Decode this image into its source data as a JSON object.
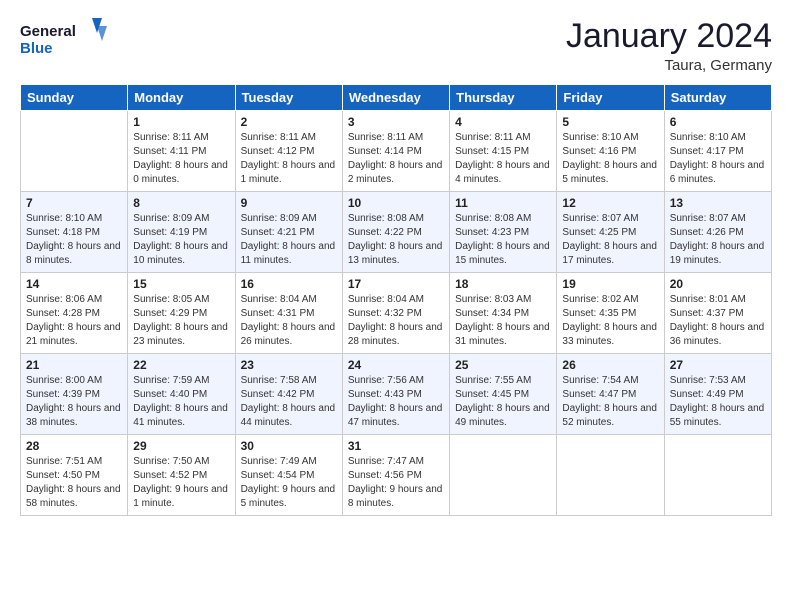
{
  "header": {
    "logo_line1": "General",
    "logo_line2": "Blue",
    "month": "January 2024",
    "location": "Taura, Germany"
  },
  "weekdays": [
    "Sunday",
    "Monday",
    "Tuesday",
    "Wednesday",
    "Thursday",
    "Friday",
    "Saturday"
  ],
  "weeks": [
    [
      {
        "day": "",
        "sunrise": "",
        "sunset": "",
        "daylight": ""
      },
      {
        "day": "1",
        "sunrise": "Sunrise: 8:11 AM",
        "sunset": "Sunset: 4:11 PM",
        "daylight": "Daylight: 8 hours and 0 minutes."
      },
      {
        "day": "2",
        "sunrise": "Sunrise: 8:11 AM",
        "sunset": "Sunset: 4:12 PM",
        "daylight": "Daylight: 8 hours and 1 minute."
      },
      {
        "day": "3",
        "sunrise": "Sunrise: 8:11 AM",
        "sunset": "Sunset: 4:14 PM",
        "daylight": "Daylight: 8 hours and 2 minutes."
      },
      {
        "day": "4",
        "sunrise": "Sunrise: 8:11 AM",
        "sunset": "Sunset: 4:15 PM",
        "daylight": "Daylight: 8 hours and 4 minutes."
      },
      {
        "day": "5",
        "sunrise": "Sunrise: 8:10 AM",
        "sunset": "Sunset: 4:16 PM",
        "daylight": "Daylight: 8 hours and 5 minutes."
      },
      {
        "day": "6",
        "sunrise": "Sunrise: 8:10 AM",
        "sunset": "Sunset: 4:17 PM",
        "daylight": "Daylight: 8 hours and 6 minutes."
      }
    ],
    [
      {
        "day": "7",
        "sunrise": "Sunrise: 8:10 AM",
        "sunset": "Sunset: 4:18 PM",
        "daylight": "Daylight: 8 hours and 8 minutes."
      },
      {
        "day": "8",
        "sunrise": "Sunrise: 8:09 AM",
        "sunset": "Sunset: 4:19 PM",
        "daylight": "Daylight: 8 hours and 10 minutes."
      },
      {
        "day": "9",
        "sunrise": "Sunrise: 8:09 AM",
        "sunset": "Sunset: 4:21 PM",
        "daylight": "Daylight: 8 hours and 11 minutes."
      },
      {
        "day": "10",
        "sunrise": "Sunrise: 8:08 AM",
        "sunset": "Sunset: 4:22 PM",
        "daylight": "Daylight: 8 hours and 13 minutes."
      },
      {
        "day": "11",
        "sunrise": "Sunrise: 8:08 AM",
        "sunset": "Sunset: 4:23 PM",
        "daylight": "Daylight: 8 hours and 15 minutes."
      },
      {
        "day": "12",
        "sunrise": "Sunrise: 8:07 AM",
        "sunset": "Sunset: 4:25 PM",
        "daylight": "Daylight: 8 hours and 17 minutes."
      },
      {
        "day": "13",
        "sunrise": "Sunrise: 8:07 AM",
        "sunset": "Sunset: 4:26 PM",
        "daylight": "Daylight: 8 hours and 19 minutes."
      }
    ],
    [
      {
        "day": "14",
        "sunrise": "Sunrise: 8:06 AM",
        "sunset": "Sunset: 4:28 PM",
        "daylight": "Daylight: 8 hours and 21 minutes."
      },
      {
        "day": "15",
        "sunrise": "Sunrise: 8:05 AM",
        "sunset": "Sunset: 4:29 PM",
        "daylight": "Daylight: 8 hours and 23 minutes."
      },
      {
        "day": "16",
        "sunrise": "Sunrise: 8:04 AM",
        "sunset": "Sunset: 4:31 PM",
        "daylight": "Daylight: 8 hours and 26 minutes."
      },
      {
        "day": "17",
        "sunrise": "Sunrise: 8:04 AM",
        "sunset": "Sunset: 4:32 PM",
        "daylight": "Daylight: 8 hours and 28 minutes."
      },
      {
        "day": "18",
        "sunrise": "Sunrise: 8:03 AM",
        "sunset": "Sunset: 4:34 PM",
        "daylight": "Daylight: 8 hours and 31 minutes."
      },
      {
        "day": "19",
        "sunrise": "Sunrise: 8:02 AM",
        "sunset": "Sunset: 4:35 PM",
        "daylight": "Daylight: 8 hours and 33 minutes."
      },
      {
        "day": "20",
        "sunrise": "Sunrise: 8:01 AM",
        "sunset": "Sunset: 4:37 PM",
        "daylight": "Daylight: 8 hours and 36 minutes."
      }
    ],
    [
      {
        "day": "21",
        "sunrise": "Sunrise: 8:00 AM",
        "sunset": "Sunset: 4:39 PM",
        "daylight": "Daylight: 8 hours and 38 minutes."
      },
      {
        "day": "22",
        "sunrise": "Sunrise: 7:59 AM",
        "sunset": "Sunset: 4:40 PM",
        "daylight": "Daylight: 8 hours and 41 minutes."
      },
      {
        "day": "23",
        "sunrise": "Sunrise: 7:58 AM",
        "sunset": "Sunset: 4:42 PM",
        "daylight": "Daylight: 8 hours and 44 minutes."
      },
      {
        "day": "24",
        "sunrise": "Sunrise: 7:56 AM",
        "sunset": "Sunset: 4:43 PM",
        "daylight": "Daylight: 8 hours and 47 minutes."
      },
      {
        "day": "25",
        "sunrise": "Sunrise: 7:55 AM",
        "sunset": "Sunset: 4:45 PM",
        "daylight": "Daylight: 8 hours and 49 minutes."
      },
      {
        "day": "26",
        "sunrise": "Sunrise: 7:54 AM",
        "sunset": "Sunset: 4:47 PM",
        "daylight": "Daylight: 8 hours and 52 minutes."
      },
      {
        "day": "27",
        "sunrise": "Sunrise: 7:53 AM",
        "sunset": "Sunset: 4:49 PM",
        "daylight": "Daylight: 8 hours and 55 minutes."
      }
    ],
    [
      {
        "day": "28",
        "sunrise": "Sunrise: 7:51 AM",
        "sunset": "Sunset: 4:50 PM",
        "daylight": "Daylight: 8 hours and 58 minutes."
      },
      {
        "day": "29",
        "sunrise": "Sunrise: 7:50 AM",
        "sunset": "Sunset: 4:52 PM",
        "daylight": "Daylight: 9 hours and 1 minute."
      },
      {
        "day": "30",
        "sunrise": "Sunrise: 7:49 AM",
        "sunset": "Sunset: 4:54 PM",
        "daylight": "Daylight: 9 hours and 5 minutes."
      },
      {
        "day": "31",
        "sunrise": "Sunrise: 7:47 AM",
        "sunset": "Sunset: 4:56 PM",
        "daylight": "Daylight: 9 hours and 8 minutes."
      },
      {
        "day": "",
        "sunrise": "",
        "sunset": "",
        "daylight": ""
      },
      {
        "day": "",
        "sunrise": "",
        "sunset": "",
        "daylight": ""
      },
      {
        "day": "",
        "sunrise": "",
        "sunset": "",
        "daylight": ""
      }
    ]
  ]
}
